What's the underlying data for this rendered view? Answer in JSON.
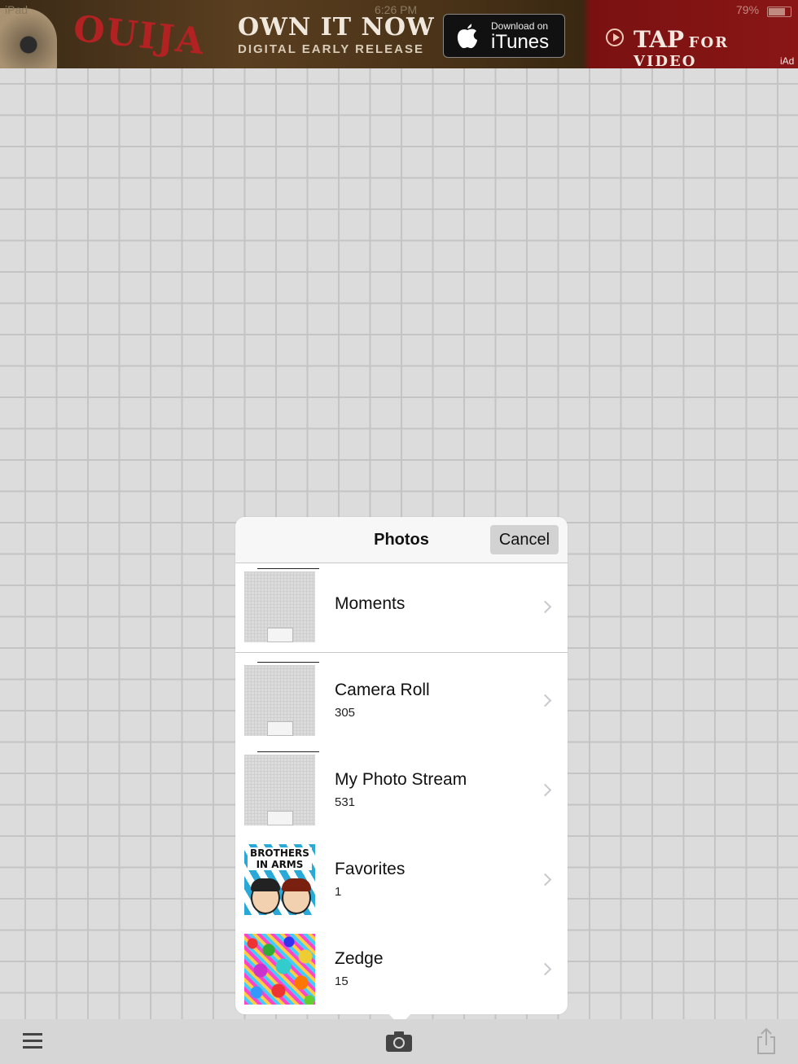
{
  "status_bar": {
    "carrier": "iPad",
    "time": "6:26 PM",
    "battery": "79%"
  },
  "ad": {
    "logo": "OUIJA",
    "headline": "OWN IT NOW",
    "subline": "DIGITAL EARLY RELEASE",
    "badge_top": "Download on",
    "badge_main": "iTunes",
    "cta_tap": "TAP",
    "cta_rest": "FOR VIDEO",
    "iad_label": "iAd"
  },
  "popover": {
    "title": "Photos",
    "cancel_label": "Cancel",
    "albums": [
      {
        "name": "Moments",
        "count": ""
      },
      {
        "name": "Camera Roll",
        "count": "305"
      },
      {
        "name": "My Photo Stream",
        "count": "531"
      },
      {
        "name": "Favorites",
        "count": "1"
      },
      {
        "name": "Zedge",
        "count": "15"
      }
    ],
    "favorites_thumb_text": "BROTHERS IN ARMS"
  },
  "toolbar": {
    "icons": [
      "menu-icon",
      "camera-icon",
      "share-icon"
    ]
  },
  "colors": {
    "grid_background": "#dcdcdc",
    "grid_line": "#c4c4c4",
    "ad_red": "#8a1616",
    "popover_bg": "#ffffff"
  }
}
